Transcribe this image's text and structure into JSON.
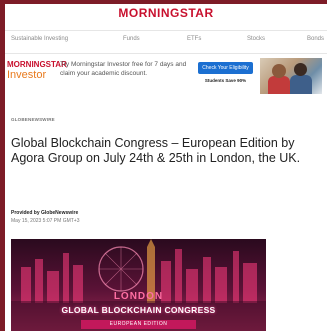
{
  "header": {
    "logo": "MORNINGSTAR"
  },
  "nav": {
    "items": [
      {
        "label": "Sustainable Investing"
      },
      {
        "label": "Funds"
      },
      {
        "label": "ETFs"
      },
      {
        "label": "Stocks"
      },
      {
        "label": "Bonds"
      }
    ]
  },
  "ad": {
    "brand_top": "MORNINGSTAR",
    "brand_bottom": "Investor",
    "text": "Try Morningstar Investor free for 7 days and claim your academic discount.",
    "button": "Check Your Eligibility",
    "sub": "Students Save 90%"
  },
  "article": {
    "label": "GLOBENEWSWIRE",
    "headline": "Global Blockchain Congress – European Edition by Agora Group on July 24th & 25th in London, the UK.",
    "byline": "Provided by GlobeNewswire",
    "date": "May 15, 2023 5:07 PM GMT+3"
  },
  "hero": {
    "city": "LONDON",
    "title": "GLOBAL BLOCKCHAIN CONGRESS",
    "edition": "EUROPEAN EDITION"
  },
  "colors": {
    "background": "#7d1c27",
    "brand_red": "#c8102e",
    "investor_orange": "#e87a1d",
    "button_blue": "#1b6fd1",
    "hero_pink": "#ff6fa3"
  }
}
